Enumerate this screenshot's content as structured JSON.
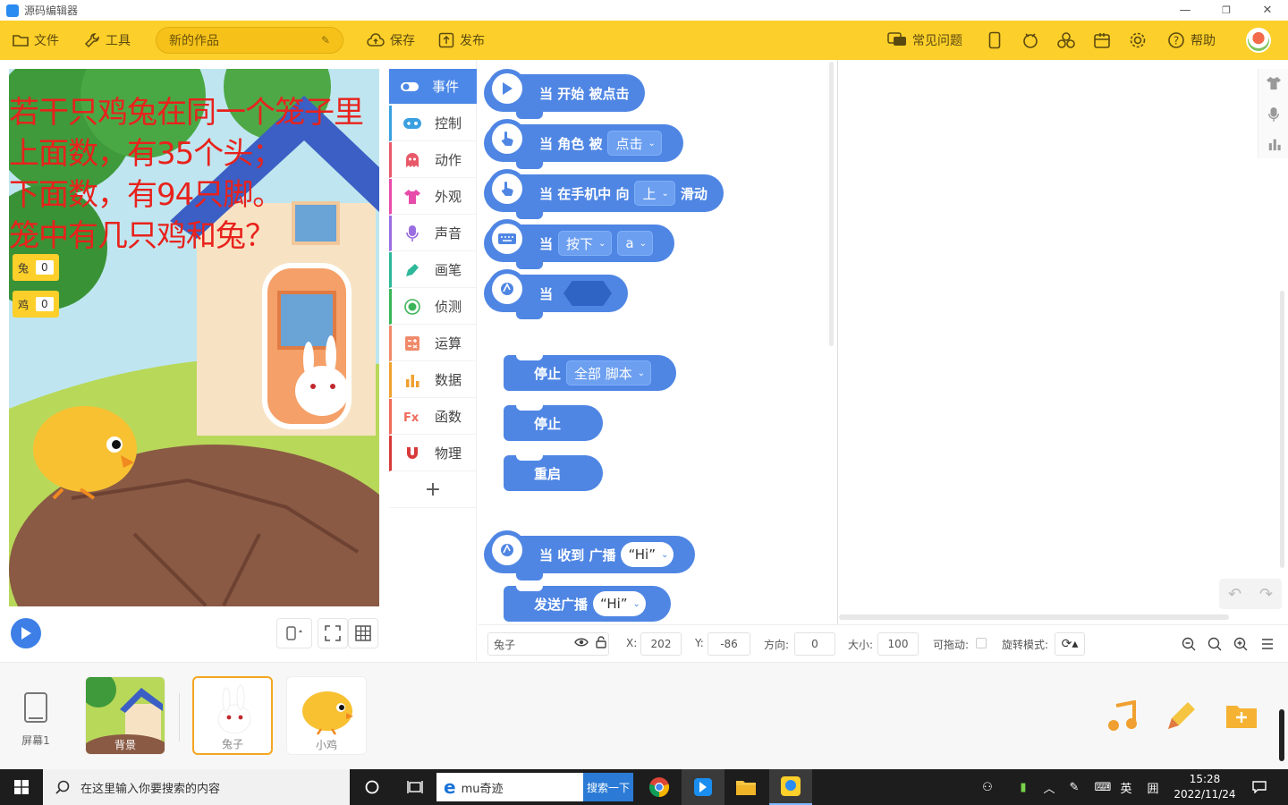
{
  "window": {
    "title": "源码编辑器",
    "minimize": "—",
    "restore": "❐",
    "close": "✕"
  },
  "toolbar": {
    "file": "文件",
    "tools": "工具",
    "project_name": "新的作品",
    "save": "保存",
    "publish": "发布",
    "faq": "常见问题",
    "help": "帮助"
  },
  "stage": {
    "text_lines": [
      "若干只鸡兔在同一个笼子里",
      "上面数，有35个头；",
      "下面数，有94只脚。",
      "笼中有几只鸡和兔？"
    ],
    "variables": [
      {
        "name": "兔",
        "value": "0"
      },
      {
        "name": "鸡",
        "value": "0"
      }
    ],
    "text_color": "#e8221c"
  },
  "categories": [
    {
      "label": "事件",
      "color": "#4c88e8",
      "icon": "toggle-icon"
    },
    {
      "label": "控制",
      "color": "#3aa0e0",
      "icon": "gamepad-icon"
    },
    {
      "label": "动作",
      "color": "#e85a6a",
      "icon": "ghost-icon"
    },
    {
      "label": "外观",
      "color": "#e84caa",
      "icon": "shirt-icon"
    },
    {
      "label": "声音",
      "color": "#9a6ee0",
      "icon": "mic-icon"
    },
    {
      "label": "画笔",
      "color": "#2eb89a",
      "icon": "pen-icon"
    },
    {
      "label": "侦测",
      "color": "#3ab55a",
      "icon": "target-icon"
    },
    {
      "label": "运算",
      "color": "#f08a6a",
      "icon": "calc-icon"
    },
    {
      "label": "数据",
      "color": "#f0a030",
      "icon": "bars-icon"
    },
    {
      "label": "函数",
      "color": "#f06a5a",
      "icon": "fx-icon"
    },
    {
      "label": "物理",
      "color": "#d83a3a",
      "icon": "magnet-icon"
    }
  ],
  "blocks": {
    "when_start": "当 开始 被点击",
    "when_sprite": "当 角色 被",
    "when_sprite_dd": "点击",
    "when_swipe_a": "当 在手机中 向",
    "when_swipe_dd": "上",
    "when_swipe_b": "滑动",
    "when_key": "当",
    "when_key_dd1": "按下",
    "when_key_dd2": "a",
    "when_cond": "当",
    "stop": "停止",
    "stop_dd": "全部 脚本",
    "stop2": "停止",
    "restart": "重启",
    "when_recv": "当 收到 广播",
    "when_recv_dd": "“Hi”",
    "broadcast": "发送广播",
    "broadcast_dd": "“Hi”"
  },
  "props": {
    "sprite_name": "兔子",
    "x_label": "X:",
    "x": "202",
    "y_label": "Y:",
    "y": "-86",
    "dir_label": "方向:",
    "dir": "0",
    "size_label": "大小:",
    "size": "100",
    "drag_label": "可拖动:",
    "rot_label": "旋转模式:"
  },
  "sprites": {
    "screen": "屏幕1",
    "items": [
      "背景",
      "兔子",
      "小鸡"
    ]
  },
  "taskbar": {
    "search_placeholder": "在这里输入你要搜索的内容",
    "ie_text": "mu奇迹",
    "ie_go": "搜索一下",
    "lang": "英",
    "time": "15:28",
    "date": "2022/11/24"
  }
}
